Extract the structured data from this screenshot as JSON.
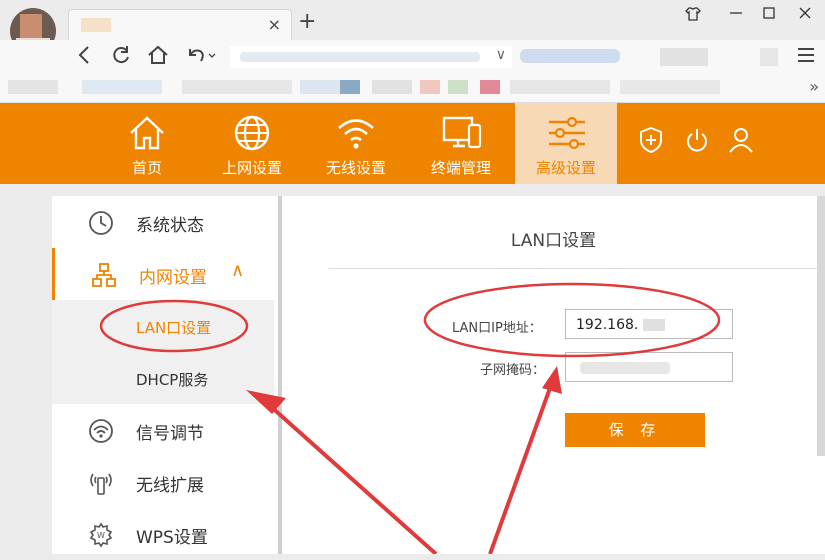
{
  "browser": {
    "new_tab": "+",
    "tab_close": "×",
    "dropdown": "∨",
    "bookmark_more": "»"
  },
  "router": {
    "nav": [
      {
        "label": "首页",
        "icon": "home-icon"
      },
      {
        "label": "上网设置",
        "icon": "globe-icon"
      },
      {
        "label": "无线设置",
        "icon": "wifi-icon"
      },
      {
        "label": "终端管理",
        "icon": "devices-icon"
      },
      {
        "label": "高级设置",
        "icon": "sliders-icon"
      }
    ],
    "header_icons": [
      "shield-icon",
      "power-icon",
      "user-icon"
    ],
    "accent": "#ef8400",
    "sidebar": {
      "items": [
        {
          "label": "系统状态",
          "icon": "clock-icon"
        },
        {
          "label": "内网设置",
          "icon": "network-icon",
          "expand": "∧"
        },
        {
          "label": "信号调节",
          "icon": "signal-icon"
        },
        {
          "label": "无线扩展",
          "icon": "antenna-icon"
        },
        {
          "label": "WPS设置",
          "icon": "wps-gear-icon"
        }
      ],
      "subitems": [
        {
          "label": "LAN口设置"
        },
        {
          "label": "DHCP服务"
        }
      ]
    },
    "main": {
      "title": "LAN口设置",
      "ip_label": "LAN口IP地址：",
      "ip_value": "192.168.",
      "mask_label": "子网掩码：",
      "mask_value": "",
      "save_label": "保 存"
    }
  }
}
